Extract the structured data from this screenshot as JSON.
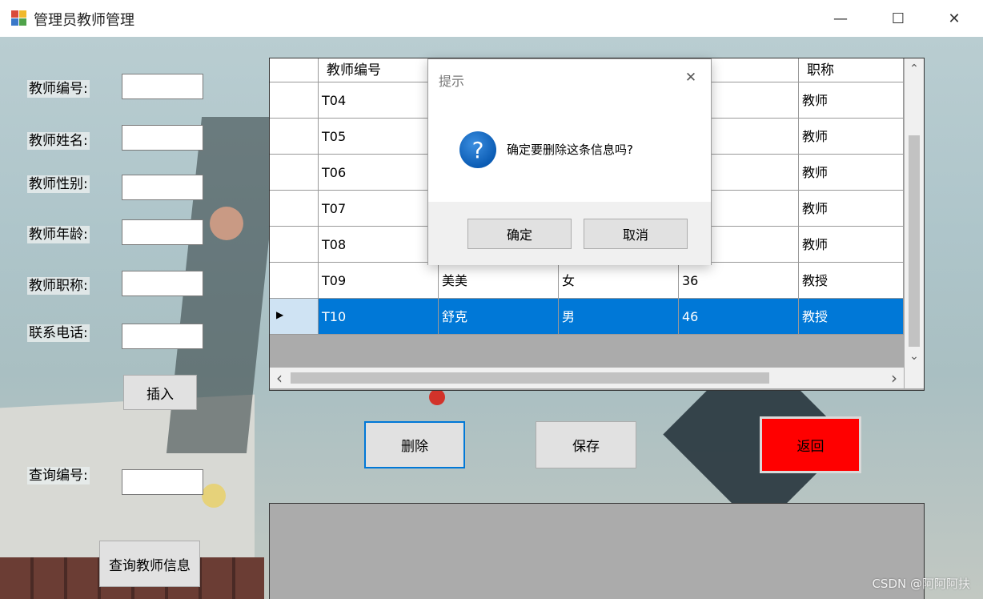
{
  "window": {
    "title": "管理员教师管理",
    "minimize_glyph": "—",
    "maximize_glyph": "☐",
    "close_glyph": "✕"
  },
  "form": {
    "teacher_id_label": "教师编号:",
    "teacher_name_label": "教师姓名:",
    "teacher_gender_label": "教师性别:",
    "teacher_age_label": "教师年龄:",
    "teacher_title_label": "教师职称:",
    "phone_label": "联系电话:",
    "insert_button": "插入",
    "query_id_label": "查询编号:",
    "query_button": "查询教师信息"
  },
  "grid": {
    "columns": [
      "教师编号",
      "",
      "",
      "",
      "职称"
    ],
    "rows": [
      {
        "id": "T04",
        "name": "",
        "gender": "",
        "age": "",
        "title": "教师"
      },
      {
        "id": "T05",
        "name": "",
        "gender": "",
        "age": "",
        "title": "教师"
      },
      {
        "id": "T06",
        "name": "",
        "gender": "",
        "age": "",
        "title": "教师"
      },
      {
        "id": "T07",
        "name": "",
        "gender": "",
        "age": "",
        "title": "教师"
      },
      {
        "id": "T08",
        "name": "",
        "gender": "",
        "age": "",
        "title": "教师"
      },
      {
        "id": "T09",
        "name": "美美",
        "gender": "女",
        "age": "36",
        "title": "教授"
      },
      {
        "id": "T10",
        "name": "舒克",
        "gender": "男",
        "age": "46",
        "title": "教授",
        "selected": true
      }
    ],
    "row_indicator_glyph": "▶",
    "scroll_up_glyph": "⌃",
    "scroll_down_glyph": "⌄",
    "scroll_left_glyph": "‹",
    "scroll_right_glyph": "›"
  },
  "actions": {
    "delete_button": "删除",
    "save_button": "保存",
    "back_button": "返回",
    "back_color": "#ff0000"
  },
  "dialog": {
    "title": "提示",
    "close_glyph": "✕",
    "icon": "question-icon",
    "icon_glyph": "?",
    "message": "确定要删除这条信息吗?",
    "ok_button": "确定",
    "cancel_button": "取消"
  },
  "watermark": "CSDN @阿阿阿扶",
  "colors": {
    "selection": "#0078d7",
    "focus_border": "#0078d7",
    "grid_background": "#ababab"
  }
}
